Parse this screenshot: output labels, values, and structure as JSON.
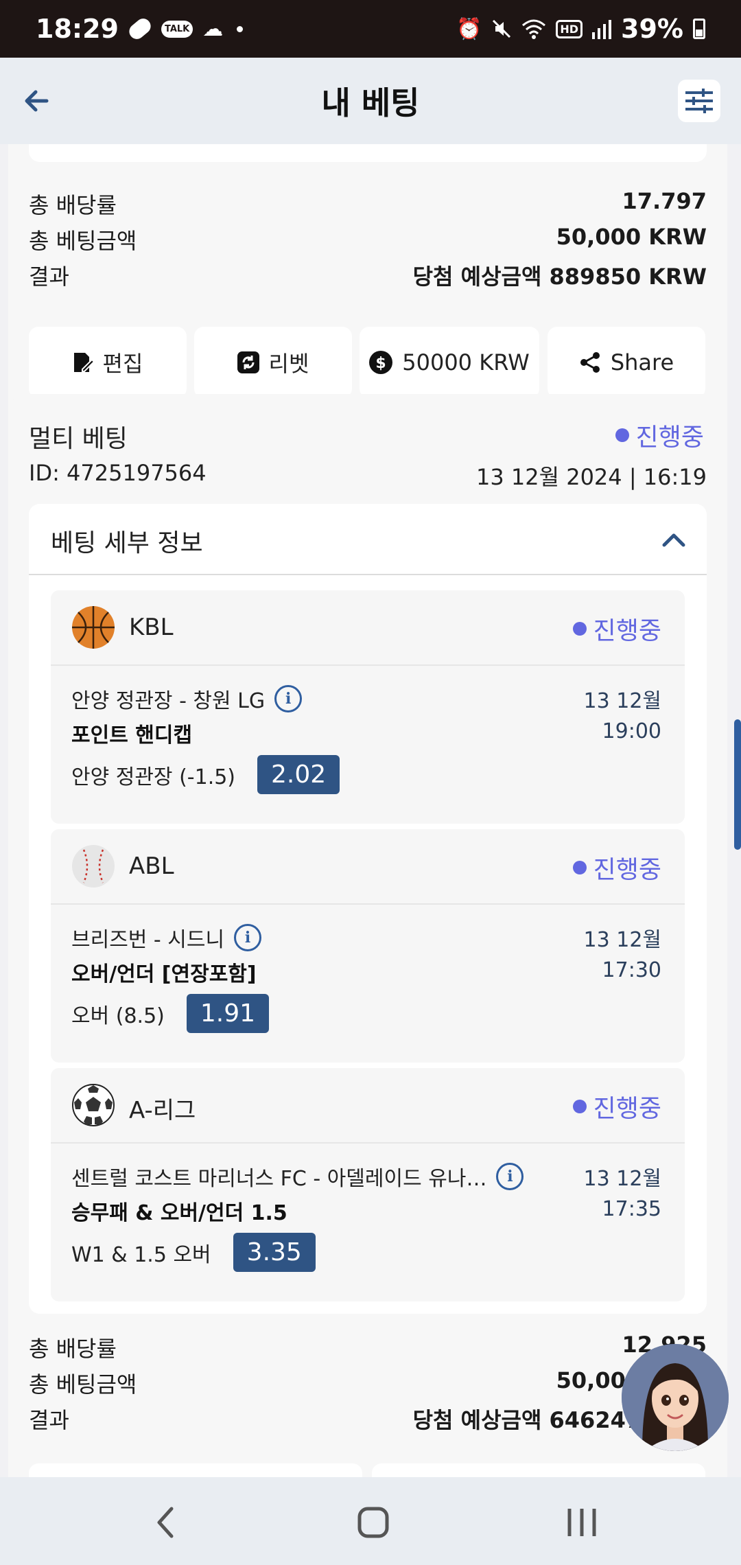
{
  "status_bar": {
    "time": "18:29",
    "battery": "39%",
    "talk_label": "TALK",
    "hd_label": "HD"
  },
  "header": {
    "title": "내 베팅"
  },
  "top_card": {
    "rows": [
      {
        "label": "총 배당률",
        "value": "17.797"
      },
      {
        "label": "총 베팅금액",
        "value": "50,000 KRW"
      },
      {
        "label": "결과",
        "value": "당첨 예상금액 889850 KRW"
      }
    ],
    "actions": {
      "edit": "편집",
      "rebet": "리벳",
      "stake": "50000 KRW",
      "share": "Share"
    }
  },
  "bet": {
    "type": "멀티 베팅",
    "status": "진행중",
    "id": "ID: 4725197564",
    "date": "13 12월 2024 | 16:19",
    "details_title": "베팅 세부 정보",
    "matches": [
      {
        "league": "KBL",
        "status": "진행중",
        "teams": "안양 정관장 - 창원 LG",
        "market": "포인트 핸디캡",
        "selection": "안양 정관장 (-1.5)",
        "odds": "2.02",
        "date": "13 12월",
        "time": "19:00",
        "icon": "basketball-icon"
      },
      {
        "league": "ABL",
        "status": "진행중",
        "teams": "브리즈번 - 시드니",
        "market": "오버/언더 [연장포함]",
        "selection": "오버 (8.5)",
        "odds": "1.91",
        "date": "13 12월",
        "time": "17:30",
        "icon": "baseball-icon"
      },
      {
        "league": "A-리그",
        "status": "진행중",
        "teams": "센트럴 코스트 마리너스 FC - 아델레이드 유나…",
        "market": "승무패 & 오버/언더 1.5",
        "selection": "W1 & 1.5 오버",
        "odds": "3.35",
        "date": "13 12월",
        "time": "17:35",
        "icon": "soccer-ball-icon"
      }
    ],
    "summary": [
      {
        "label": "총 배당률",
        "value": "12.925"
      },
      {
        "label": "총 베팅금액",
        "value": "50,000 KRW"
      },
      {
        "label": "결과",
        "value": "당첨 예상금액 646247 KRW"
      }
    ]
  },
  "colors": {
    "accent": "#6167e0",
    "odds_bg": "#2f5484",
    "header_bg": "#e9edf2",
    "status_bar_bg": "#1e1514"
  }
}
